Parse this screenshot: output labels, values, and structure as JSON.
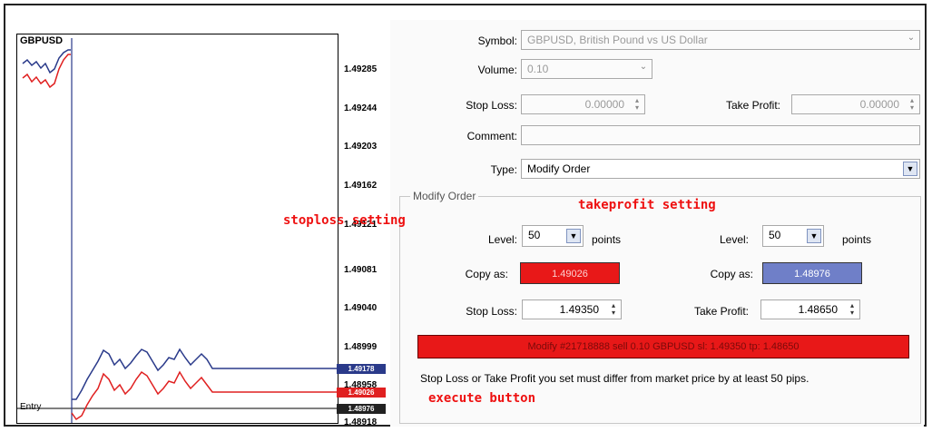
{
  "chart": {
    "symbol": "GBPUSD",
    "entry_label": "Entry",
    "prices": [
      "1.49285",
      "1.49244",
      "1.49203",
      "1.49162",
      "1.49121",
      "1.49081",
      "1.49040",
      "1.48999",
      "1.48958",
      "1.48918"
    ],
    "tags": [
      "1.49178",
      "1.49026",
      "1.48976"
    ]
  },
  "form": {
    "symbol_label": "Symbol:",
    "symbol_value": "GBPUSD, British Pound vs US Dollar",
    "volume_label": "Volume:",
    "volume_value": "0.10",
    "stop_loss_label": "Stop Loss:",
    "stop_loss_value": "0.00000",
    "take_profit_label": "Take Profit:",
    "take_profit_value": "0.00000",
    "comment_label": "Comment:",
    "comment_value": "",
    "type_label": "Type:",
    "type_value": "Modify Order"
  },
  "modify": {
    "group_title": "Modify Order",
    "sl_level_label": "Level:",
    "sl_level_value": "50",
    "sl_points_label": "points",
    "tp_level_label": "Level:",
    "tp_level_value": "50",
    "tp_points_label": "points",
    "copy_as_label_sl": "Copy as:",
    "copy_as_value_sl": "1.49026",
    "copy_as_label_tp": "Copy as:",
    "copy_as_value_tp": "1.48976",
    "stop_loss_label": "Stop Loss:",
    "stop_loss_value": "1.49350",
    "take_profit_label": "Take Profit:",
    "take_profit_value": "1.48650",
    "execute_label": "Modify #21718888 sell 0.10 GBPUSD sl: 1.49350 tp: 1.48650",
    "note": "Stop Loss or Take Profit you set must differ from market price by at least 50 pips."
  },
  "annotations": {
    "stoploss": "stoploss setting",
    "takeprofit": "takeprofit setting",
    "execute": "execute button"
  },
  "colors": {
    "red_button": "#e81818",
    "blue_button": "#6f7fc8",
    "annotation": "#ee1010",
    "bid_line": "#2a3a8a",
    "ask_line": "#e02020"
  }
}
